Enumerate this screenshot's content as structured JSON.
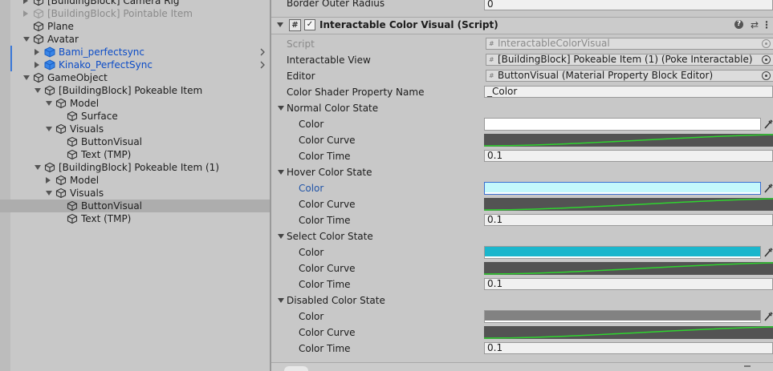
{
  "hierarchy": {
    "items": [
      {
        "label": "[BuildingBlock] Camera Rig",
        "indent": 1,
        "arrow": "right",
        "faded": false,
        "prefab": false
      },
      {
        "label": "[BuildingBlock] Pointable Item",
        "indent": 1,
        "arrow": "right",
        "faded": true,
        "prefab": false
      },
      {
        "label": "Plane",
        "indent": 1,
        "arrow": "none",
        "faded": false,
        "prefab": false
      },
      {
        "label": "Avatar",
        "indent": 1,
        "arrow": "down",
        "faded": false,
        "prefab": false
      },
      {
        "label": "Bami_perfectsync",
        "indent": 2,
        "arrow": "right",
        "faded": false,
        "prefab": true
      },
      {
        "label": "Kinako_PerfectSync",
        "indent": 2,
        "arrow": "right",
        "faded": false,
        "prefab": true
      },
      {
        "label": "GameObject",
        "indent": 1,
        "arrow": "down",
        "faded": false,
        "prefab": false
      },
      {
        "label": "[BuildingBlock] Pokeable Item",
        "indent": 2,
        "arrow": "down",
        "faded": false,
        "prefab": false
      },
      {
        "label": "Model",
        "indent": 3,
        "arrow": "down",
        "faded": false,
        "prefab": false
      },
      {
        "label": "Surface",
        "indent": 4,
        "arrow": "none",
        "faded": false,
        "prefab": false
      },
      {
        "label": "Visuals",
        "indent": 3,
        "arrow": "down",
        "faded": false,
        "prefab": false
      },
      {
        "label": "ButtonVisual",
        "indent": 4,
        "arrow": "none",
        "faded": false,
        "prefab": false
      },
      {
        "label": "Text (TMP)",
        "indent": 4,
        "arrow": "none",
        "faded": false,
        "prefab": false
      },
      {
        "label": "[BuildingBlock] Pokeable Item (1)",
        "indent": 2,
        "arrow": "down",
        "faded": false,
        "prefab": false
      },
      {
        "label": "Model",
        "indent": 3,
        "arrow": "right",
        "faded": false,
        "prefab": false
      },
      {
        "label": "Visuals",
        "indent": 3,
        "arrow": "down",
        "faded": false,
        "prefab": false
      },
      {
        "label": "ButtonVisual",
        "indent": 4,
        "arrow": "none",
        "faded": false,
        "prefab": false,
        "selected": true
      },
      {
        "label": "Text (TMP)",
        "indent": 4,
        "arrow": "none",
        "faded": false,
        "prefab": false
      }
    ]
  },
  "inspector": {
    "top_partial_label": "Border Outer Radius",
    "top_partial_value": "0",
    "component_title": "Interactable Color Visual (Script)",
    "component_enabled": true,
    "header_icons": [
      "help-icon",
      "preset-icon",
      "more-icon"
    ],
    "script_label": "Script",
    "script_value": "InteractableColorVisual",
    "interactable_view_label": "Interactable View",
    "interactable_view_value": "[BuildingBlock] Pokeable Item (1) (Poke Interactable)",
    "editor_label": "Editor",
    "editor_value": "ButtonVisual (Material Property Block Editor)",
    "shader_prop_label": "Color Shader Property Name",
    "shader_prop_value": "_Color",
    "states": [
      {
        "title": "Normal Color State",
        "color_label": "Color",
        "color_hex": "#ffffff",
        "highlight": false,
        "curve_label": "Color Curve",
        "time_label": "Color Time",
        "time_value": "0.1"
      },
      {
        "title": "Hover Color State",
        "color_label": "Color",
        "color_hex": "#c3f8fc",
        "highlight": true,
        "curve_label": "Color Curve",
        "time_label": "Color Time",
        "time_value": "0.1"
      },
      {
        "title": "Select Color State",
        "color_label": "Color",
        "color_hex": "#1bb6cc",
        "highlight": false,
        "curve_label": "Color Curve",
        "time_label": "Color Time",
        "time_value": "0.1"
      },
      {
        "title": "Disabled Color State",
        "color_label": "Color",
        "color_hex": "#828282",
        "highlight": false,
        "curve_label": "Color Curve",
        "time_label": "Color Time",
        "time_value": "0.1"
      }
    ]
  },
  "colors": {
    "prefab_text": "#0b4cc7",
    "highlight_label": "#2255a8",
    "curve_line": "#2fd42f",
    "curve_bg": "#535353"
  }
}
